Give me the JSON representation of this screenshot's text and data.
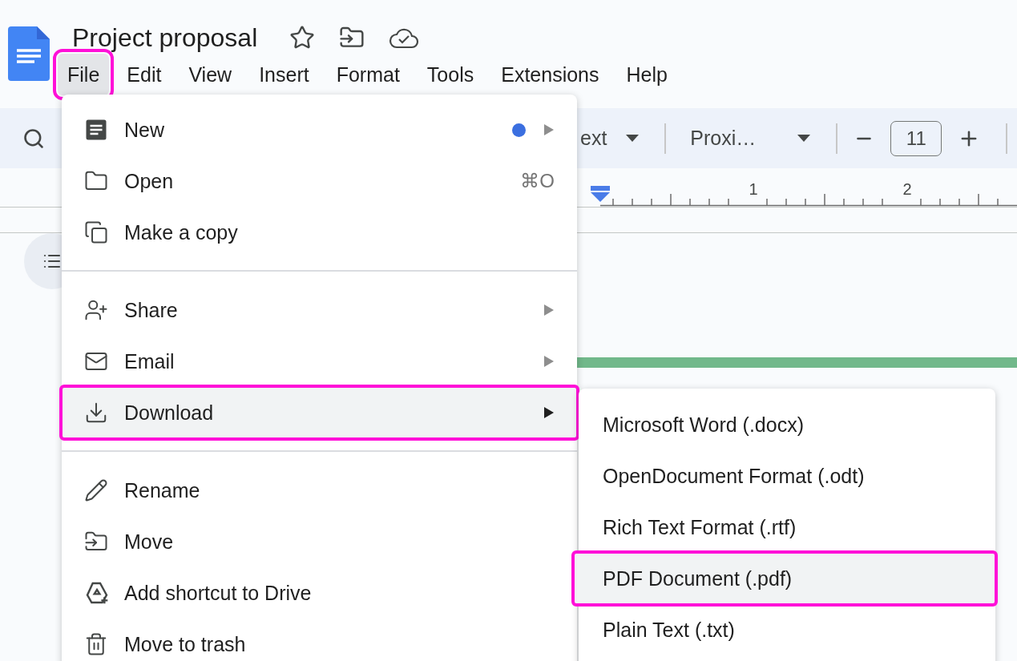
{
  "app": {
    "title": "Project proposal"
  },
  "menu_bar": [
    {
      "label": "File",
      "selected": true,
      "annotated": true
    },
    {
      "label": "Edit",
      "selected": false,
      "annotated": false
    },
    {
      "label": "View",
      "selected": false,
      "annotated": false
    },
    {
      "label": "Insert",
      "selected": false,
      "annotated": false
    },
    {
      "label": "Format",
      "selected": false,
      "annotated": false
    },
    {
      "label": "Tools",
      "selected": false,
      "annotated": false
    },
    {
      "label": "Extensions",
      "selected": false,
      "annotated": false
    },
    {
      "label": "Help",
      "selected": false,
      "annotated": false
    }
  ],
  "toolbar": {
    "style_dropdown": "ext",
    "font_dropdown": "Proxi…",
    "font_size": "11"
  },
  "ruler": {
    "labels": [
      "1",
      "2"
    ]
  },
  "file_menu": {
    "items": [
      {
        "kind": "item",
        "label": "New",
        "submenu": true,
        "new_badge": true,
        "highlighted": false,
        "annotated": false
      },
      {
        "kind": "item",
        "label": "Open",
        "shortcut": "⌘O",
        "submenu": false,
        "highlighted": false,
        "annotated": false
      },
      {
        "kind": "item",
        "label": "Make a copy",
        "submenu": false,
        "highlighted": false,
        "annotated": false
      },
      {
        "kind": "divider"
      },
      {
        "kind": "item",
        "label": "Share",
        "submenu": true,
        "highlighted": false,
        "annotated": false
      },
      {
        "kind": "item",
        "label": "Email",
        "submenu": true,
        "highlighted": false,
        "annotated": false
      },
      {
        "kind": "item",
        "label": "Download",
        "submenu": true,
        "highlighted": true,
        "annotated": true
      },
      {
        "kind": "divider"
      },
      {
        "kind": "item",
        "label": "Rename",
        "submenu": false,
        "highlighted": false,
        "annotated": false
      },
      {
        "kind": "item",
        "label": "Move",
        "submenu": false,
        "highlighted": false,
        "annotated": false
      },
      {
        "kind": "item",
        "label": "Add shortcut to Drive",
        "submenu": false,
        "highlighted": false,
        "annotated": false
      },
      {
        "kind": "item",
        "label": "Move to trash",
        "submenu": false,
        "highlighted": false,
        "annotated": false
      }
    ]
  },
  "download_menu": {
    "items": [
      {
        "label": "Microsoft Word (.docx)",
        "highlighted": false,
        "annotated": false
      },
      {
        "label": "OpenDocument Format (.odt)",
        "highlighted": false,
        "annotated": false
      },
      {
        "label": "Rich Text Format (.rtf)",
        "highlighted": false,
        "annotated": false
      },
      {
        "label": "PDF Document (.pdf)",
        "highlighted": true,
        "annotated": true
      },
      {
        "label": "Plain Text (.txt)",
        "highlighted": false,
        "annotated": false
      }
    ]
  }
}
